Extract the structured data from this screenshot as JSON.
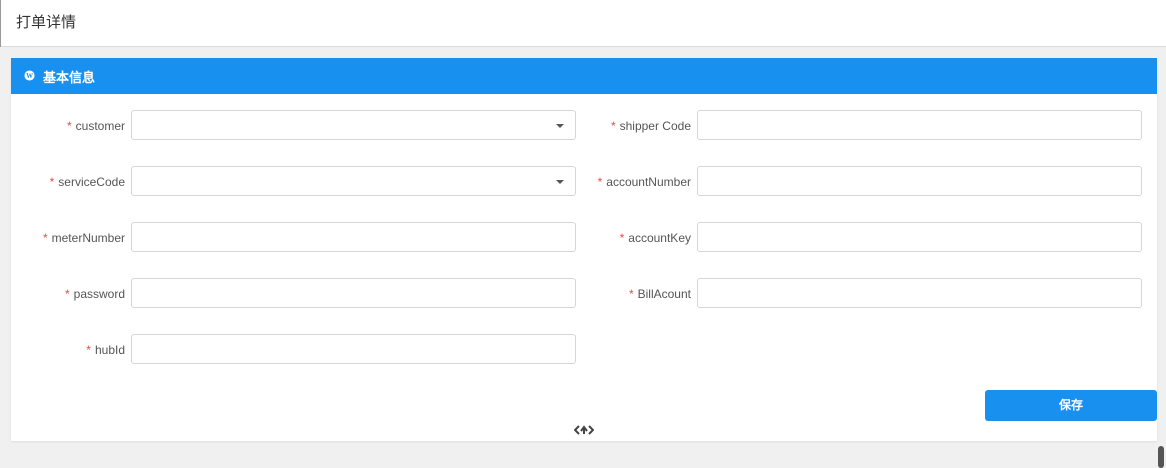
{
  "header": {
    "title": "打单详情"
  },
  "panel": {
    "title": "基本信息",
    "icon": "wordpress-icon"
  },
  "form": {
    "required_mark": "*",
    "left": [
      {
        "label": "customer",
        "type": "select",
        "value": ""
      },
      {
        "label": "serviceCode",
        "type": "select",
        "value": ""
      },
      {
        "label": "meterNumber",
        "type": "text",
        "value": ""
      },
      {
        "label": "password",
        "type": "text",
        "value": ""
      },
      {
        "label": "hubId",
        "type": "text",
        "value": ""
      }
    ],
    "right": [
      {
        "label": "shipper Code",
        "type": "text",
        "value": ""
      },
      {
        "label": "accountNumber",
        "type": "text",
        "value": ""
      },
      {
        "label": "accountKey",
        "type": "text",
        "value": ""
      },
      {
        "label": "BillAcount",
        "type": "text",
        "value": ""
      }
    ]
  },
  "actions": {
    "save_label": "保存"
  },
  "colors": {
    "accent": "#1890f0",
    "required": "#e74c3c"
  }
}
